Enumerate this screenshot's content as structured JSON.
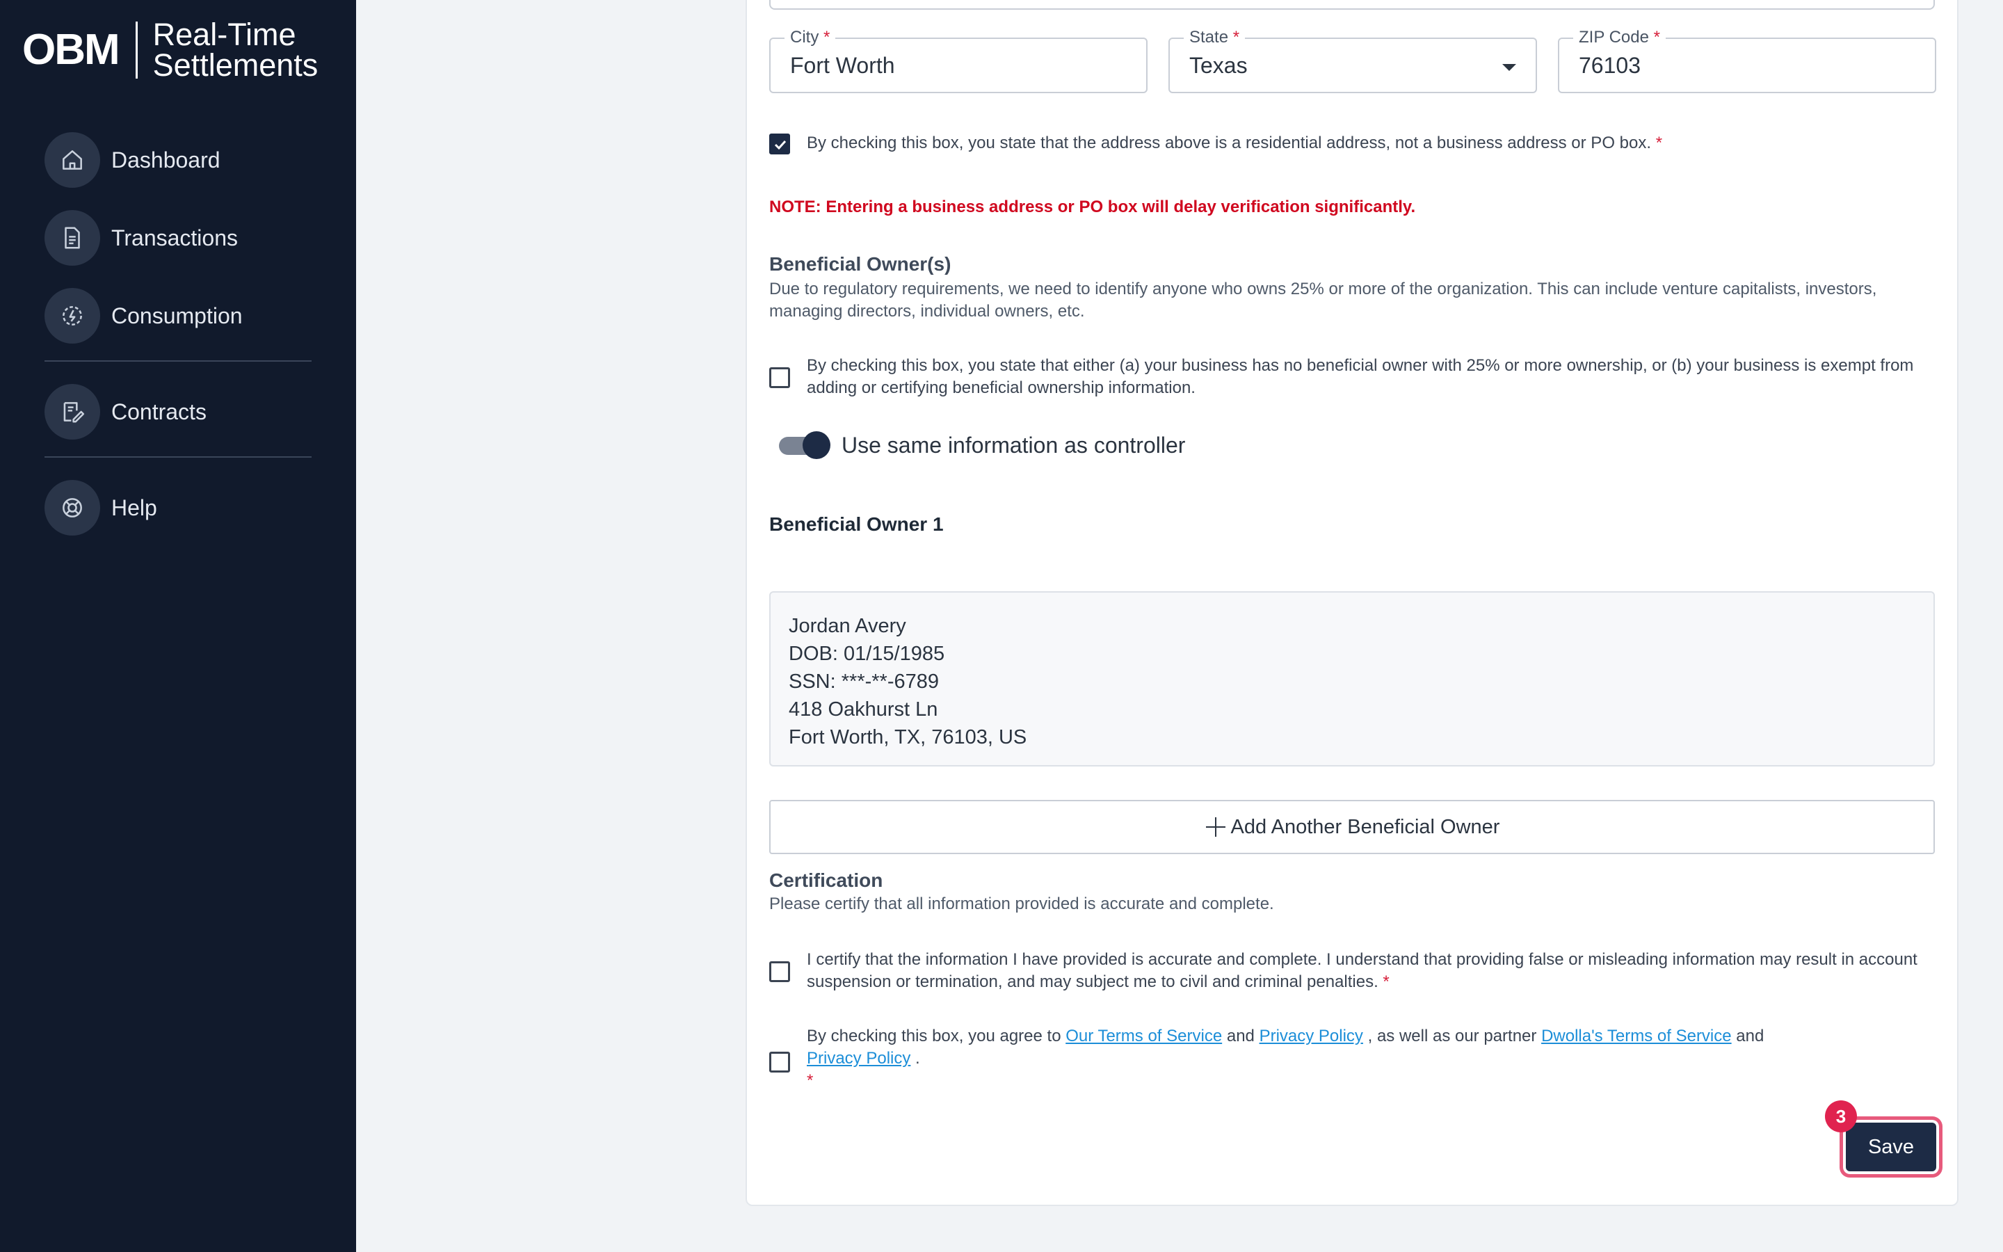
{
  "brand": {
    "logo": "OBM",
    "name_line1": "Real-Time",
    "name_line2": "Settlements"
  },
  "sidebar": {
    "items": [
      {
        "label": "Dashboard",
        "icon": "home-icon"
      },
      {
        "label": "Transactions",
        "icon": "document-icon"
      },
      {
        "label": "Consumption",
        "icon": "energy-icon"
      },
      {
        "label": "Contracts",
        "icon": "contract-icon"
      },
      {
        "label": "Help",
        "icon": "lifebuoy-icon"
      }
    ]
  },
  "address": {
    "city_label": "City",
    "city_value": "Fort Worth",
    "state_label": "State",
    "state_value": "Texas",
    "zip_label": "ZIP Code",
    "zip_value": "76103",
    "required_mark": "*"
  },
  "residential_checkbox": {
    "checked": true,
    "text": "By checking this box, you state that the address above is a residential address, not a business address or PO box."
  },
  "note": "NOTE: Entering a business address or PO box will delay verification significantly.",
  "beneficial": {
    "title": "Beneficial Owner(s)",
    "description": "Due to regulatory requirements, we need to identify anyone who owns 25% or more of the organization. This can include venture capitalists, investors, managing directors, individual owners, etc.",
    "exempt_checkbox_text": "By checking this box, you state that either (a) your business has no beneficial owner with 25% or more ownership, or (b) your business is exempt from adding or certifying beneficial ownership information.",
    "toggle_label": "Use same information as controller",
    "toggle_on": true,
    "owner_heading": "Beneficial Owner 1",
    "owner_lines": [
      "Jordan Avery",
      "DOB: 01/15/1985",
      "SSN: ***-**-6789",
      "418 Oakhurst Ln",
      "Fort Worth, TX, 76103, US"
    ],
    "add_button": "Add Another Beneficial Owner"
  },
  "certification": {
    "title": "Certification",
    "subtitle": "Please certify that all information provided is accurate and complete.",
    "certify_text": "I certify that the information I have provided is accurate and complete. I understand that providing false or misleading information may result in account suspension or termination, and may subject me to civil and criminal penalties.",
    "terms_prefix": "By checking this box, you agree to",
    "terms_link1": "Our Terms of Service",
    "and1": "and",
    "privacy_link1": "Privacy Policy",
    "partner_text": ", as well as our partner",
    "terms_link2": "Dwolla's Terms of Service",
    "and2": "and",
    "privacy_link2": "Privacy Policy",
    "period": "."
  },
  "save": {
    "label": "Save",
    "badge": "3"
  },
  "colors": {
    "sidebar_bg": "#111a2c",
    "primary": "#1d2b45",
    "required": "#d61f3a",
    "note": "#d0081f",
    "link": "#1c8ed8",
    "badge": "#e0234f"
  }
}
